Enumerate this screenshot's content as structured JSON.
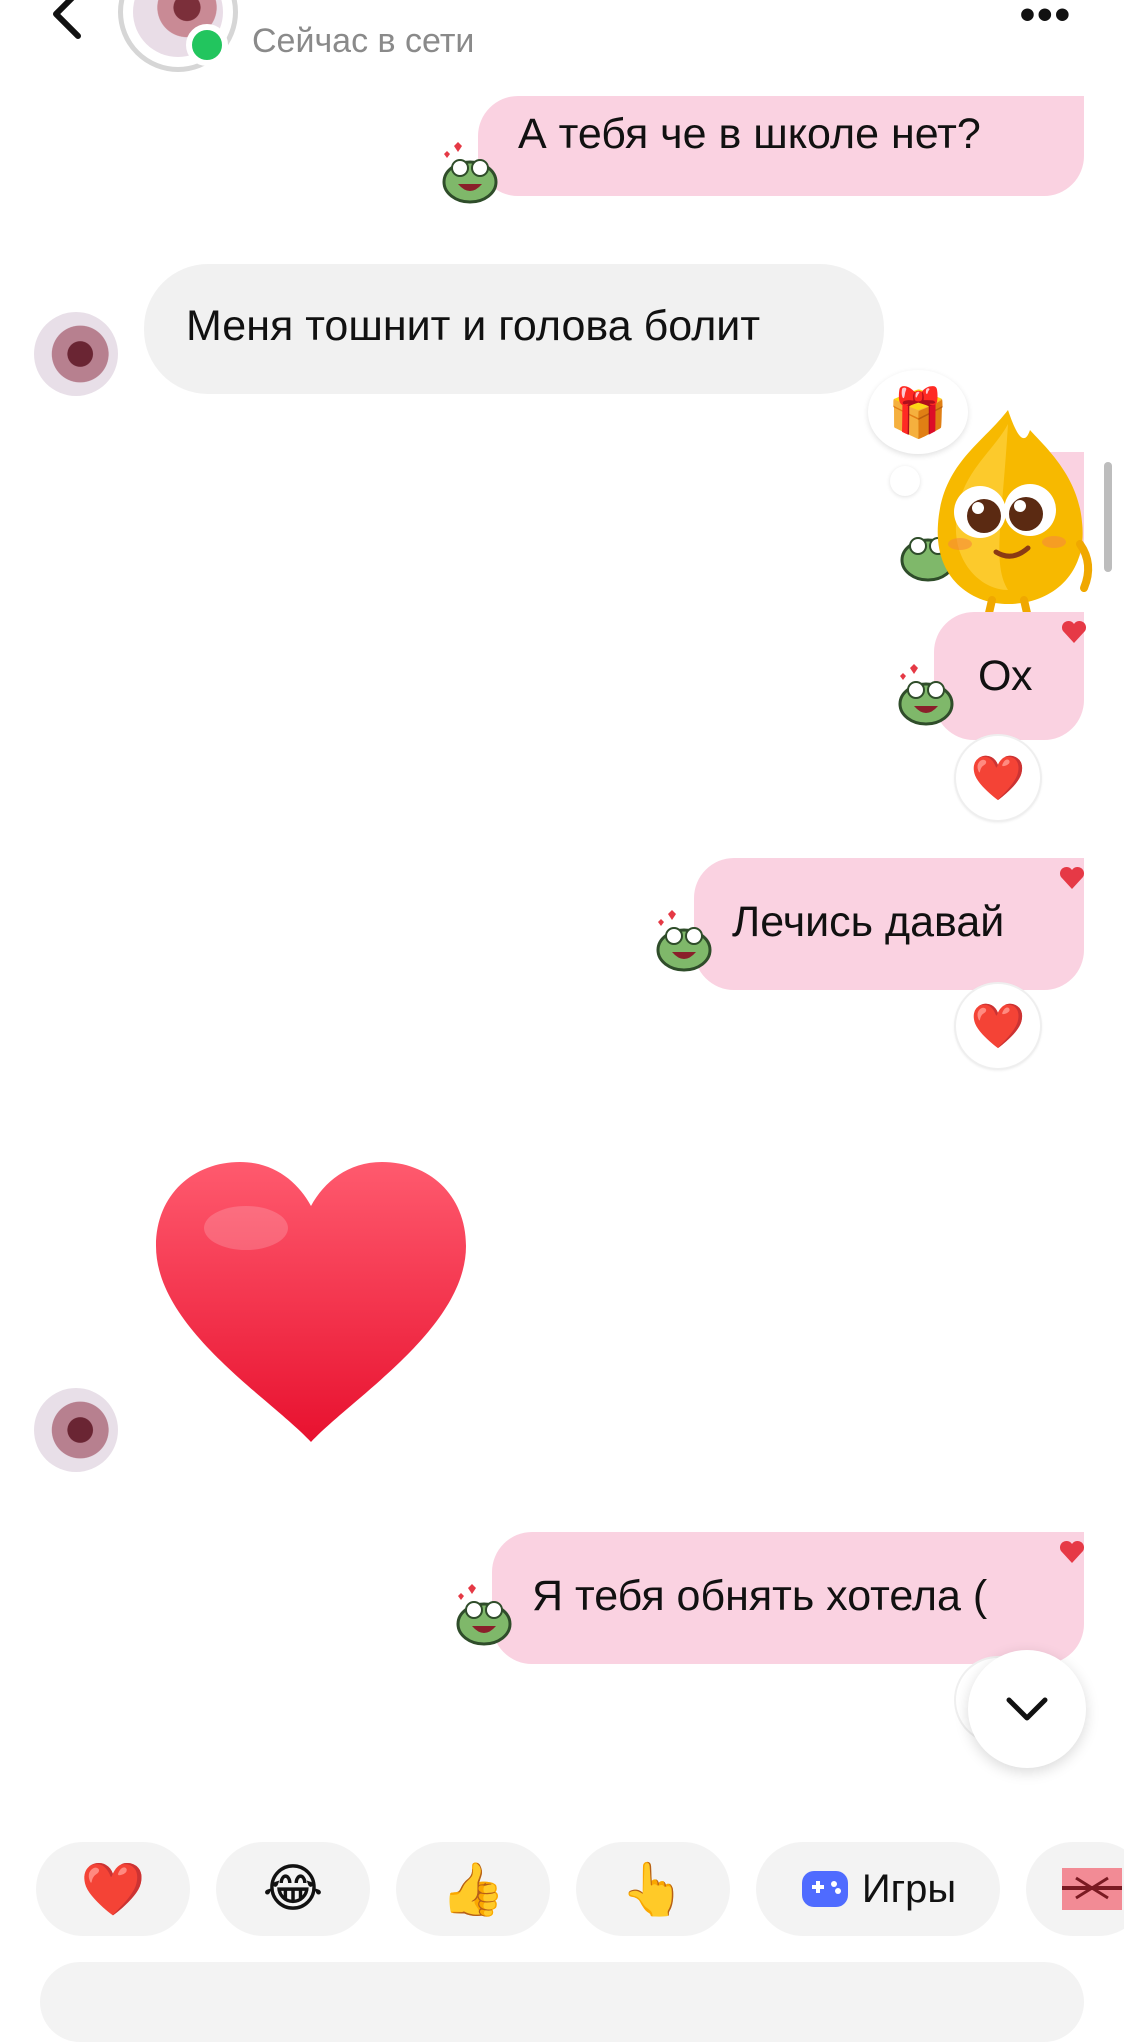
{
  "header": {
    "status": "Сейчас в сети",
    "back_icon": "chevron-left-icon",
    "more_icon": "more-dots-icon"
  },
  "messages": [
    {
      "from": "me",
      "text": "А тебя че в школе нет?"
    },
    {
      "from": "them",
      "text": "Меня тошнит и голова болит"
    },
    {
      "from": "me",
      "type": "sticker",
      "sticker": "yellow-flame-character-with-gift"
    },
    {
      "from": "me",
      "text": "Ох",
      "reaction": "❤️"
    },
    {
      "from": "me",
      "text": "Лечись давай",
      "reaction": "❤️"
    },
    {
      "from": "them",
      "type": "emoji",
      "emoji": "heart"
    },
    {
      "from": "me",
      "text": "Я тебя обнять хотела ("
    }
  ],
  "reactions": {
    "heart": "❤️"
  },
  "quick_replies": [
    {
      "emoji": "❤️"
    },
    {
      "emoji": "😂"
    },
    {
      "emoji": "👍"
    },
    {
      "emoji": "👆"
    },
    {
      "label": "Игры",
      "icon": "gamepad-icon"
    },
    {
      "icon": "gift-icon"
    }
  ],
  "colors": {
    "my_bubble": "#fad2e1",
    "their_bubble": "#f1f1f1",
    "online": "#22c55e",
    "accent": "#e63946"
  }
}
